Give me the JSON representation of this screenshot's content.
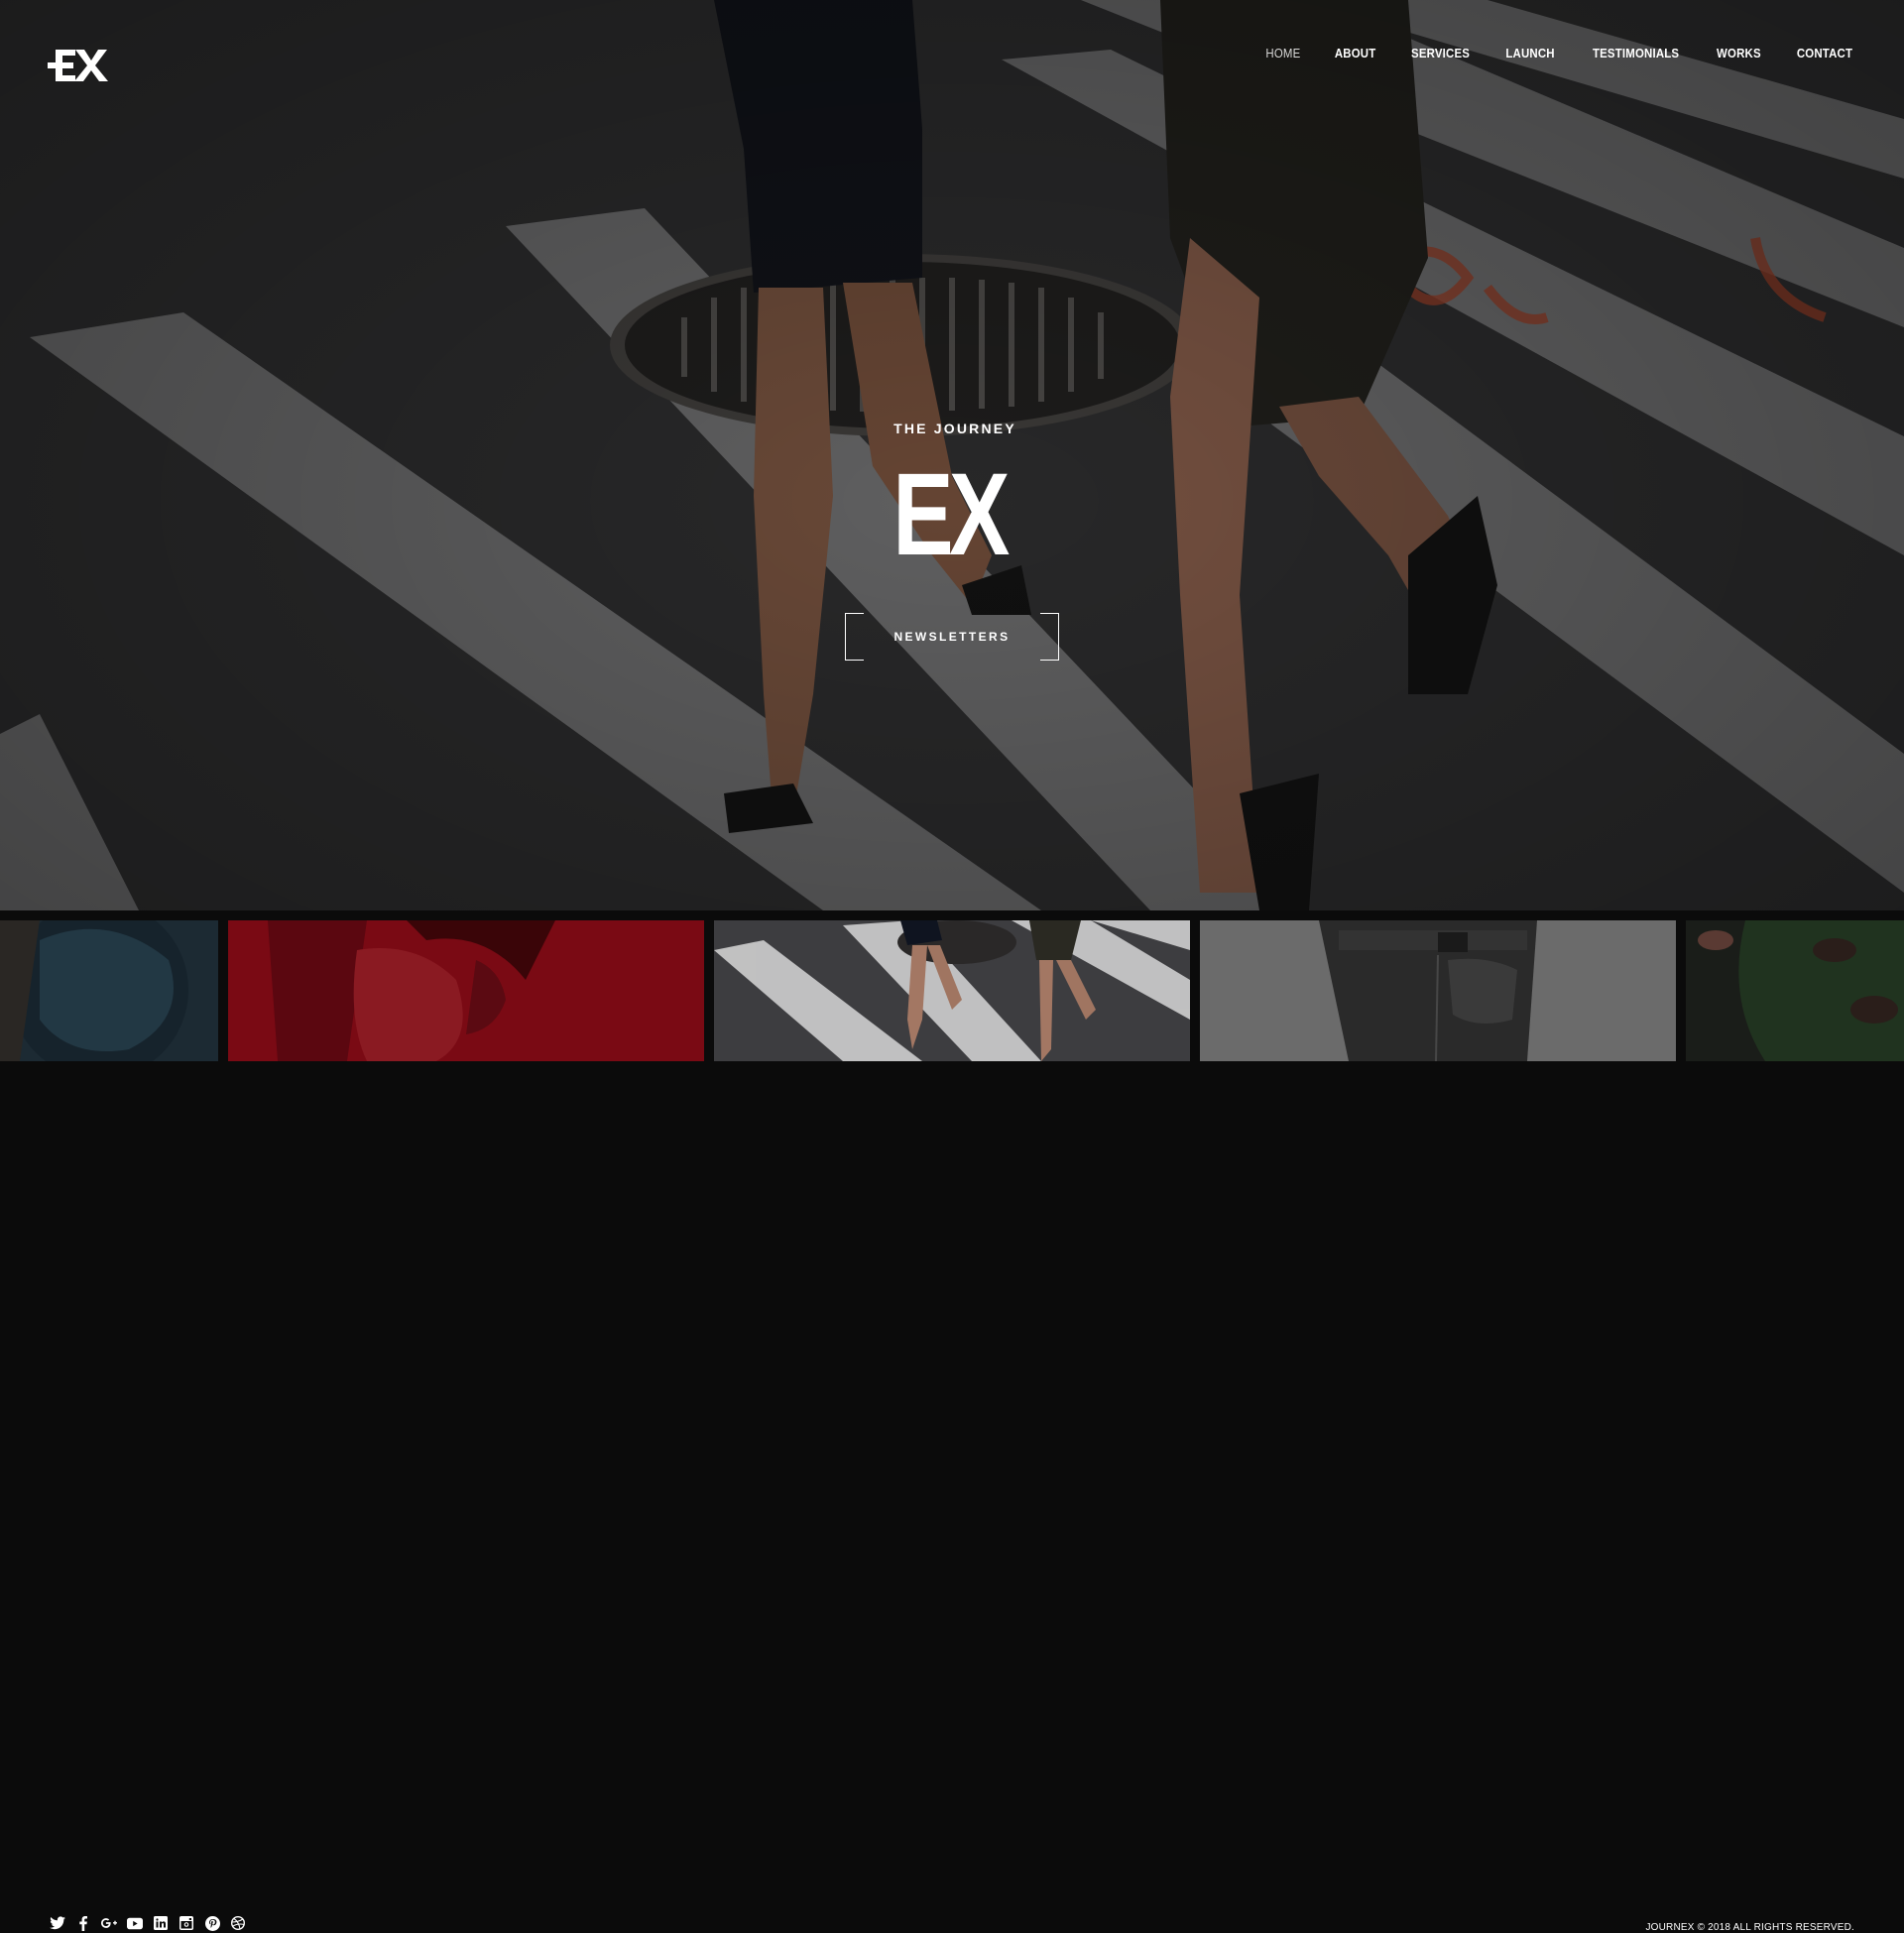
{
  "header": {
    "logo_alt": "EX",
    "nav": [
      {
        "label": "HOME"
      },
      {
        "label": "ABOUT"
      },
      {
        "label": "SERVICES"
      },
      {
        "label": "LAUNCH"
      },
      {
        "label": "TESTIMONIALS"
      },
      {
        "label": "WORKS"
      },
      {
        "label": "CONTACT"
      }
    ],
    "active_item": "HOME"
  },
  "hero": {
    "kicker": "THE JOURNEY",
    "title": "EX",
    "button_label": "NEWSLETTERS"
  },
  "gallery": {
    "thumbnails": [
      {
        "name": "hat"
      },
      {
        "name": "red-portrait"
      },
      {
        "name": "crosswalk-heels"
      },
      {
        "name": "jeans-back"
      },
      {
        "name": "green-leaf"
      }
    ]
  },
  "social": {
    "icons": [
      "twitter-icon",
      "facebook-icon",
      "google-plus-icon",
      "youtube-icon",
      "linkedin-icon",
      "instagram-icon",
      "pinterest-icon",
      "dribbble-icon"
    ]
  },
  "footer": {
    "copyright": "JOURNEX © 2018 ALL RIGHTS RESERVED."
  },
  "colors": {
    "text": "#ffffff",
    "background": "#0b0b0b",
    "red_accent": "#7a0a14"
  }
}
